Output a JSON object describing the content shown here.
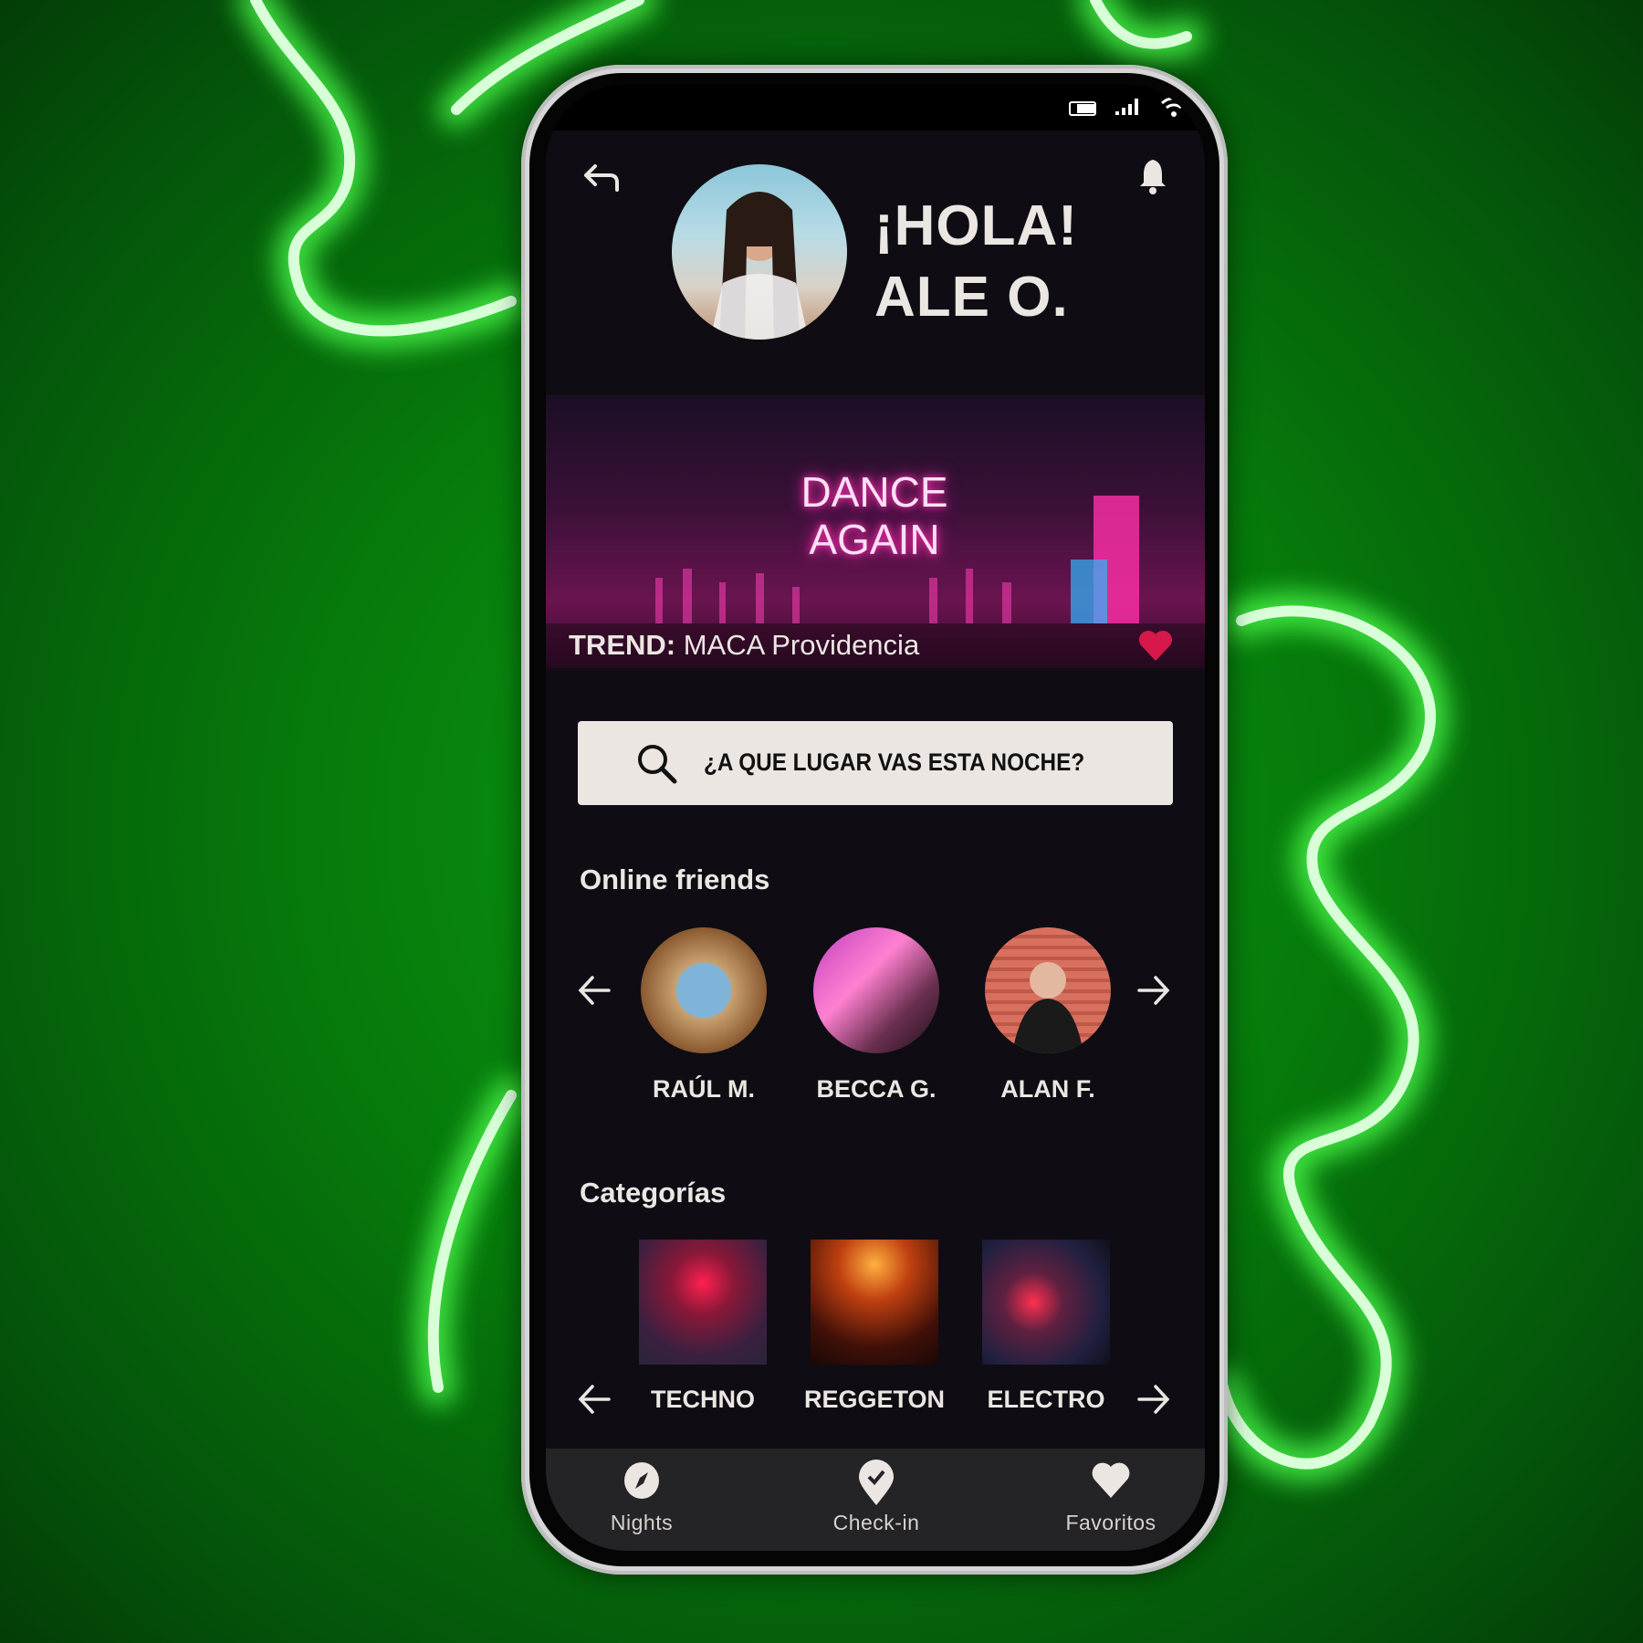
{
  "status_bar": {
    "icons": [
      "battery-icon",
      "signal-icon",
      "wifi-icon"
    ]
  },
  "header": {
    "greeting": "¡HOLA!",
    "user_name": "ALE O.",
    "back_icon": "back-arrow-icon",
    "notification_icon": "bell-icon"
  },
  "banner": {
    "sign_line1": "DANCE",
    "sign_line2": "AGAIN",
    "trend_label": "TREND:",
    "trend_value": "MACA Providencia",
    "heart_color": "#d6184a"
  },
  "search": {
    "placeholder": "¿A QUE LUGAR VAS ESTA NOCHE?"
  },
  "friends": {
    "title": "Online friends",
    "items": [
      {
        "name": "RAÚL M."
      },
      {
        "name": "BECCA G."
      },
      {
        "name": "ALAN F."
      }
    ]
  },
  "categories": {
    "title": "Categorías",
    "items": [
      {
        "name": "TECHNO"
      },
      {
        "name": "REGGETON"
      },
      {
        "name": "ELECTRO"
      }
    ]
  },
  "bottom_nav": {
    "items": [
      {
        "label": "Nights",
        "icon": "compass-icon"
      },
      {
        "label": "Check-in",
        "icon": "location-check-icon"
      },
      {
        "label": "Favoritos",
        "icon": "heart-icon"
      }
    ]
  },
  "colors": {
    "background_neon": "#39ff3a",
    "screen_bg": "#0f0d13",
    "text": "#ece6e3",
    "nav_bg": "#242326",
    "banner_accent": "#ff2fb0"
  }
}
